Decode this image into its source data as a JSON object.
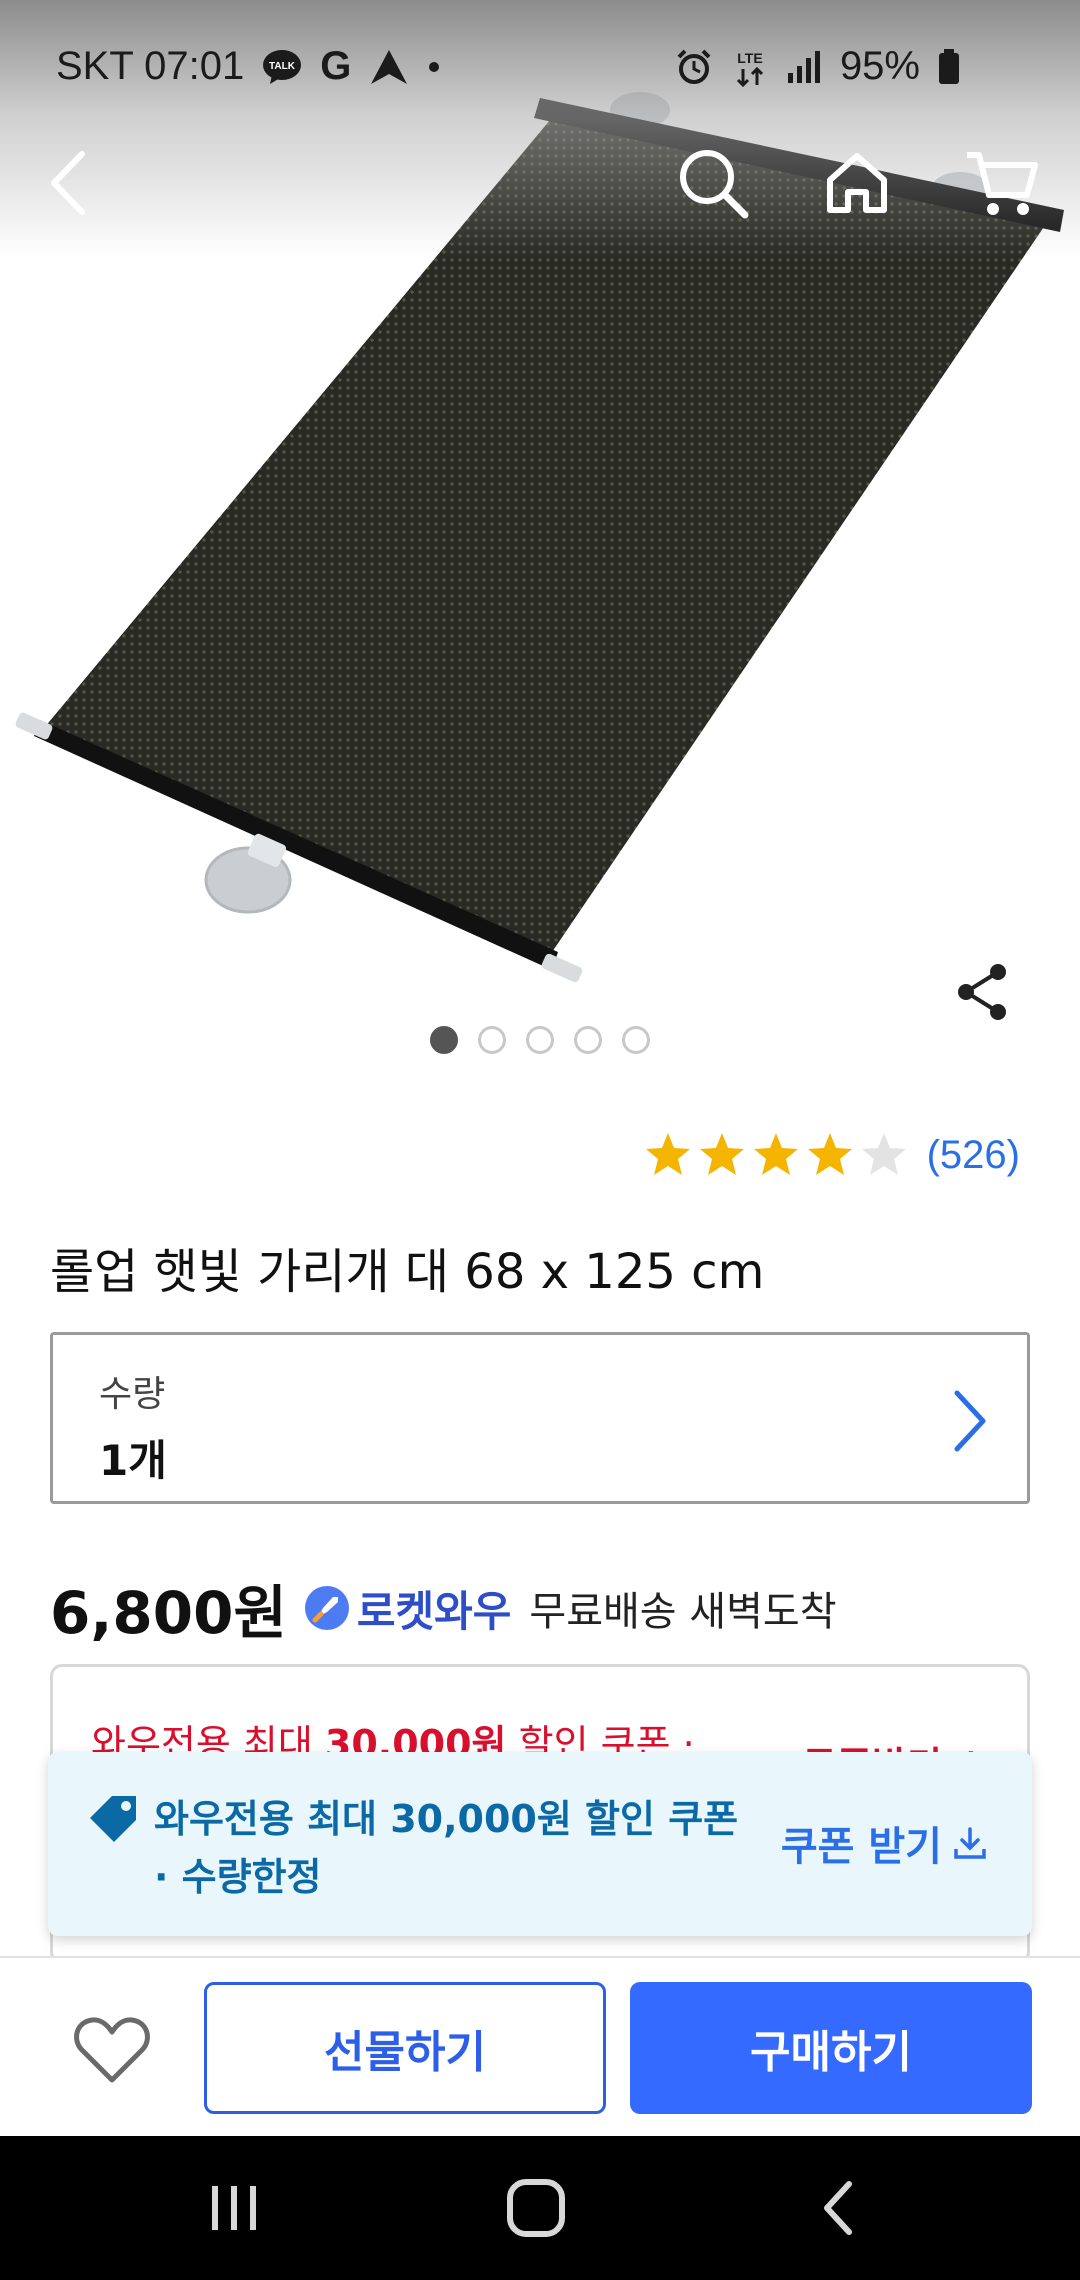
{
  "status_bar": {
    "carrier_time": "SKT 07:01",
    "talk_badge": "TALK",
    "g_letter": "G",
    "lte_label": "LTE",
    "battery": "95%"
  },
  "nav": {
    "icons": [
      "back-icon",
      "search-icon",
      "home-icon",
      "cart-icon"
    ]
  },
  "carousel": {
    "total_images": 5,
    "active_index": 0
  },
  "rating": {
    "stars": 4,
    "max_stars": 5,
    "count_text": "(526)"
  },
  "product": {
    "title": "롤업 햇빛 가리개 대 68 x 125 cm"
  },
  "quantity": {
    "label": "수량",
    "value": "1개"
  },
  "price": {
    "amount": "6,800원",
    "badge": "로켓와우",
    "delivery": "무료배송 새벽도착"
  },
  "coupon_card": {
    "prefix": "와우전용 최대 ",
    "amount": "30,000원",
    "suffix": " 할인 쿠폰 ·",
    "right_label": "쿠폰받기 ↓"
  },
  "floating_coupon": {
    "line1": "와우전용 최대 30,000원 할인 쿠폰",
    "line2": "· 수량한정",
    "action": "쿠폰 받기"
  },
  "buy_bar": {
    "gift_label": "선물하기",
    "buy_label": "구매하기"
  },
  "colors": {
    "accent_blue": "#346aff",
    "coupon_red": "#d9102d",
    "star_gold": "#f5b400",
    "banner_bg": "#e9f6fb"
  }
}
